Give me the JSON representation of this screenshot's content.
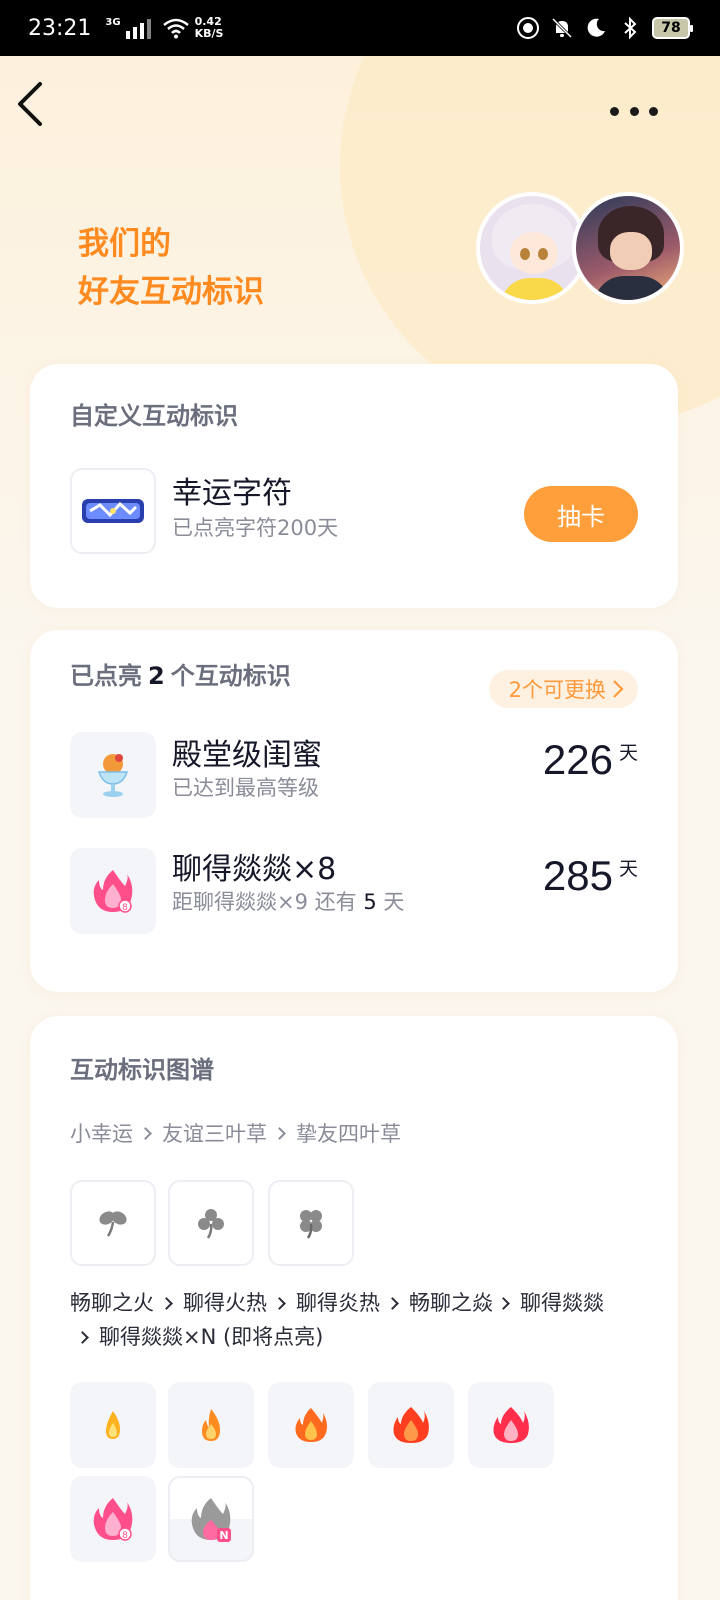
{
  "status_bar": {
    "time": "23:21",
    "network": "3G",
    "speed_top": "0.42",
    "speed_bottom": "KB/S",
    "battery": "78"
  },
  "header": {
    "title_line1": "我们的",
    "title_line2": "好友互动标识"
  },
  "custom_section": {
    "title": "自定义互动标识",
    "item_name": "幸运字符",
    "item_sub": "已点亮字符200天",
    "action_label": "抽卡"
  },
  "lit_section": {
    "title_prefix": "已点亮",
    "count": "2",
    "title_suffix": "个互动标识",
    "swap_label": "2个可更换",
    "items": [
      {
        "name": "殿堂级闺蜜",
        "sub": "已达到最高等级",
        "days": "226",
        "unit": "天"
      },
      {
        "name": "聊得燚燚×8",
        "sub_prefix": "距聊得燚燚×9 还有 ",
        "sub_num": "5",
        "sub_suffix": " 天",
        "days": "285",
        "unit": "天"
      }
    ]
  },
  "atlas_section": {
    "title": "互动标识图谱",
    "clover_chain": [
      "小幸运",
      "友谊三叶草",
      "挚友四叶草"
    ],
    "fire_chain": [
      "畅聊之火",
      "聊得火热",
      "聊得炎热",
      "畅聊之焱",
      "聊得燚燚",
      "聊得燚燚×N (即将点亮)"
    ]
  },
  "colors": {
    "accent_orange": "#ff8a1f",
    "button_orange": "#ff9f3c",
    "text_dark": "#16182a",
    "text_muted": "#8a8d99"
  }
}
